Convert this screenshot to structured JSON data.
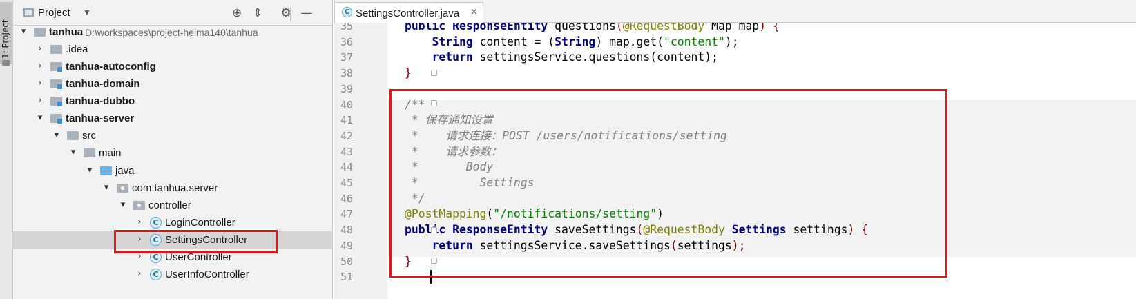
{
  "sidebar_strip": {
    "tab_label": "1: Project"
  },
  "project_panel": {
    "title": "Project",
    "dropdown_icon": "chevron-down-icon",
    "header_buttons": [
      "crosshair-icon",
      "collapse-icon",
      "gear-icon",
      "minimize-icon"
    ]
  },
  "tree": [
    {
      "label": "tanhua",
      "path": "D:\\workspaces\\project-heima140\\tanhua",
      "depth": 0,
      "arrow": "▾",
      "icon": "folder",
      "bold": true
    },
    {
      "label": ".idea",
      "depth": 1,
      "arrow": "›",
      "icon": "folder",
      "bold": false
    },
    {
      "label": "tanhua-autoconfig",
      "depth": 1,
      "arrow": "›",
      "icon": "module",
      "bold": true
    },
    {
      "label": "tanhua-domain",
      "depth": 1,
      "arrow": "›",
      "icon": "module",
      "bold": true
    },
    {
      "label": "tanhua-dubbo",
      "depth": 1,
      "arrow": "›",
      "icon": "module",
      "bold": true
    },
    {
      "label": "tanhua-server",
      "depth": 1,
      "arrow": "▾",
      "icon": "module",
      "bold": true
    },
    {
      "label": "src",
      "depth": 2,
      "arrow": "▾",
      "icon": "folder",
      "bold": false
    },
    {
      "label": "main",
      "depth": 3,
      "arrow": "▾",
      "icon": "folder",
      "bold": false
    },
    {
      "label": "java",
      "depth": 4,
      "arrow": "▾",
      "icon": "java-folder",
      "bold": false
    },
    {
      "label": "com.tanhua.server",
      "depth": 5,
      "arrow": "▾",
      "icon": "package",
      "bold": false
    },
    {
      "label": "controller",
      "depth": 6,
      "arrow": "▾",
      "icon": "package",
      "bold": false
    },
    {
      "label": "LoginController",
      "depth": 7,
      "arrow": "›",
      "icon": "class",
      "bold": false
    },
    {
      "label": "SettingsController",
      "depth": 7,
      "arrow": "›",
      "icon": "class",
      "bold": false,
      "selected": true
    },
    {
      "label": "UserController",
      "depth": 7,
      "arrow": "›",
      "icon": "class",
      "bold": false
    },
    {
      "label": "UserInfoController",
      "depth": 7,
      "arrow": "›",
      "icon": "class",
      "bold": false
    }
  ],
  "editor": {
    "tab_label": "SettingsController.java",
    "tab_close": "×",
    "class_icon_letter": "C",
    "line_numbers": [
      "35",
      "36",
      "37",
      "38",
      "39",
      "40",
      "41",
      "42",
      "43",
      "44",
      "45",
      "46",
      "47",
      "48",
      "49",
      "50",
      "51"
    ],
    "lines": {
      "l35": {
        "indent": "",
        "a": "public ",
        "b": "ResponseEntity ",
        "c": "questions",
        "d": "(",
        "e": "@RequestBody ",
        "f": "Map map",
        "g": ") {"
      },
      "l36": {
        "indent": "    ",
        "a": "String ",
        "b": "content = (",
        "c": "String",
        "d": ") map.get(",
        "e": "\"content\"",
        "f": ");"
      },
      "l37": {
        "indent": "    ",
        "a": "return ",
        "b": "settingsService.questions(",
        "c": "content",
        "d": ");"
      },
      "l38": {
        "text": "}"
      },
      "l39": {
        "text": ""
      },
      "l40": {
        "text": "/**"
      },
      "l41": {
        "text": " * 保存通知设置"
      },
      "l42": {
        "text": " *    请求连接：POST /users/notifications/setting"
      },
      "l43": {
        "text": " *    请求参数："
      },
      "l44": {
        "text": " *       Body"
      },
      "l45": {
        "text": " *         Settings"
      },
      "l46": {
        "text": " */"
      },
      "l47": {
        "ann": "@PostMapping",
        "open": "(",
        "str": "\"/notifications/setting\"",
        "close": ")"
      },
      "l48": {
        "kw": "public ",
        "type": "ResponseEntity ",
        "method": "saveSettings",
        "open": "(",
        "ann": "@RequestBody ",
        "ptype": "Settings ",
        "pname": "settings",
        "close": ") {"
      },
      "l49": {
        "kw": "return ",
        "call": "settingsService.saveSettings",
        "open": "(",
        "arg": "settings",
        "close": ");"
      },
      "l50": {
        "text": "}"
      },
      "l51": {
        "text": ""
      }
    }
  },
  "colors": {
    "highlight_box": "#e0181e",
    "keyword": "#000080",
    "string": "#008000",
    "annotation": "#808000",
    "comment": "#808080"
  }
}
